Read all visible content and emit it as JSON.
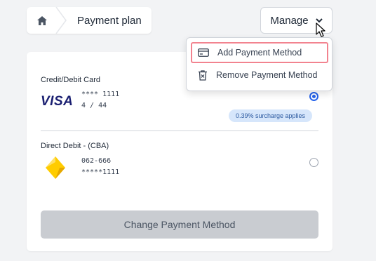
{
  "breadcrumb": {
    "home_icon": "home-icon",
    "title": "Payment plan"
  },
  "manage": {
    "label": "Manage",
    "icon": "chevron-down-icon"
  },
  "menu": {
    "items": [
      {
        "label": "Add Payment Method",
        "icon": "credit-card-icon"
      },
      {
        "label": "Remove Payment Method",
        "icon": "trash-icon"
      }
    ]
  },
  "methods": [
    {
      "type_label": "Credit/Debit Card",
      "brand": "VISA",
      "line1": "**** 1111",
      "line2": "4 / 44",
      "selected": true,
      "badge": "0.39% surcharge applies"
    },
    {
      "type_label": "Direct Debit - (CBA)",
      "brand": "CBA",
      "line1": "062-666",
      "line2": "*****1111",
      "selected": false
    }
  ],
  "change_button": {
    "label": "Change Payment Method"
  },
  "colors": {
    "accent": "#2563eb",
    "highlight": "#f2838f",
    "badge_bg": "#d6e6fb",
    "visa": "#1a1f71",
    "cba_yellow": "#ffcc00"
  }
}
